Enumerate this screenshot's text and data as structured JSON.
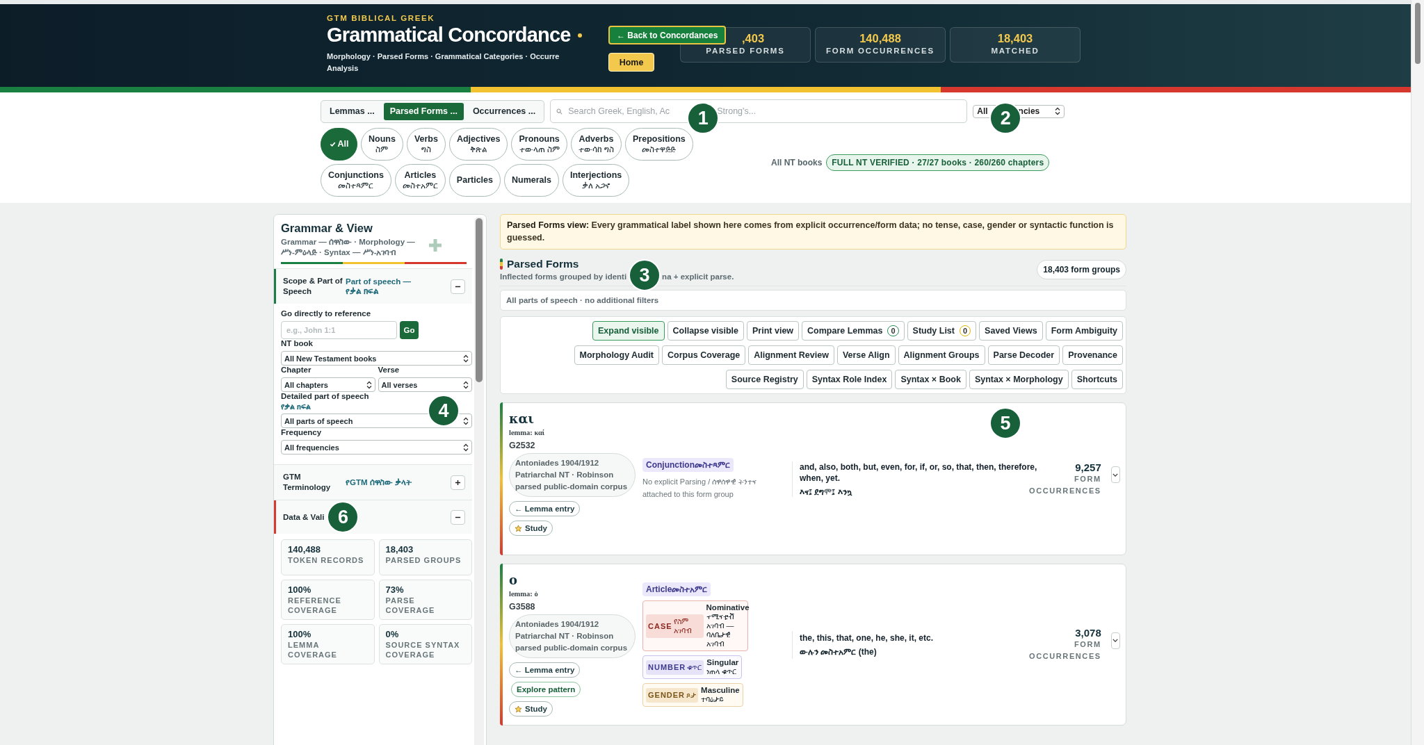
{
  "header": {
    "eyebrow": "GTM BIBLICAL GREEK",
    "title": "Grammatical Concordance",
    "subtitle_lines": [
      "Morphology · Parsed Forms · Grammatical Categories · Occurre",
      "Analysis"
    ],
    "back_button": "← Back to Concordances",
    "home_button": "Home",
    "stats": [
      {
        "value": ",403",
        "label": "PARSED FORMS"
      },
      {
        "value": "140,488",
        "label": "FORM OCCURRENCES"
      },
      {
        "value": "18,403",
        "label": "MATCHED"
      }
    ]
  },
  "view_tabs": [
    {
      "label": "Lemmas ...",
      "selected": false
    },
    {
      "label": "Parsed Forms ...",
      "selected": true
    },
    {
      "label": "Occurrences ...",
      "selected": false
    }
  ],
  "search": {
    "placeholder": "Search Greek, English, Ac",
    "placeholder_tail": "Strong's..."
  },
  "frequency_select": {
    "value": "All",
    "value_tail": "ncies"
  },
  "pos_chips": [
    {
      "label": "All",
      "selected": true
    },
    {
      "label": "Nouns",
      "amharic": "ስም",
      "selected": false
    },
    {
      "label": "Verbs",
      "amharic": "ግስ",
      "selected": false
    },
    {
      "label": "Adjectives",
      "amharic": "ቅጽል",
      "selected": false
    },
    {
      "label": "Pronouns",
      "amharic": "ተውላጠ ስም",
      "selected": false
    },
    {
      "label": "Adverbs",
      "amharic": "ተውሳከ ግስ",
      "selected": false
    },
    {
      "label": "Prepositions",
      "amharic": "መስተዋድድ",
      "selected": false
    },
    {
      "label": "Conjunctions",
      "amharic": "መስተጻምር",
      "selected": false
    },
    {
      "label": "Articles",
      "amharic": "መስተአምር",
      "selected": false
    },
    {
      "label": "Particles",
      "selected": false
    },
    {
      "label": "Numerals",
      "selected": false
    },
    {
      "label": "Interjections",
      "amharic": "ቃለ አጋኖ",
      "selected": false
    }
  ],
  "coverage": {
    "label": "All NT books",
    "badge": "FULL NT VERIFIED · 27/27 books · 260/260 chapters"
  },
  "sidebar": {
    "title": "Grammar & View",
    "subtitle": "Grammar — ሰዋስው · Morphology — ሥነ-ምዕላድ · Syntax — ሥነ-አገባብ",
    "sections": [
      {
        "kind": "filters",
        "title": "Scope & Part of Speech",
        "aside": "Part of speech — የቃል ክፍል",
        "expanded": true,
        "color": "#1e7b45",
        "reference": {
          "label": "Go directly to reference",
          "placeholder": "e.g., John 1:1",
          "button": "Go"
        },
        "field_rows": [
          [
            {
              "label": "NT book",
              "value": "All New Testament books"
            }
          ],
          [
            {
              "label": "Chapter",
              "value": "All chapters"
            },
            {
              "label": "Verse",
              "value": "All verses"
            }
          ],
          [
            {
              "label": "Detailed part of speech",
              "label_am": "የቃል ክፍል",
              "value": "All parts of speech"
            }
          ],
          [
            {
              "label": "Frequency",
              "value": "All frequencies"
            }
          ]
        ]
      },
      {
        "kind": "terms",
        "title": "GTM Terminology",
        "aside": "የGTM ሰዋስው ቃላት",
        "expanded": false
      },
      {
        "kind": "stats",
        "title": "Data & Vali",
        "expanded": true,
        "color": "#d63a2f",
        "tiles": [
          {
            "value": "140,488",
            "label": "TOKEN RECORDS"
          },
          {
            "value": "18,403",
            "label": "PARSED GROUPS"
          },
          {
            "value": "100%",
            "label": "REFERENCE COVERAGE"
          },
          {
            "value": "73%",
            "label": "PARSE COVERAGE"
          },
          {
            "value": "100%",
            "label": "LEMMA COVERAGE"
          },
          {
            "value": "0%",
            "label": "SOURCE SYNTAX COVERAGE"
          }
        ]
      }
    ]
  },
  "notice": "**Parsed Forms view:** Every grammatical label shown here comes from explicit occurrence/form data; no tense, case, gender or syntactic function is guessed.",
  "results": {
    "title": "Parsed Forms",
    "subtitle": "Inflected forms grouped by identi",
    "subtitle_tail": "na + explicit parse.",
    "count": "18,403 form groups"
  },
  "filter_summary": "All parts of speech · no additional filters",
  "tool_rows": [
    [
      {
        "label": "Expand visible",
        "selected": true
      },
      {
        "label": "Collapse visible",
        "selected": false
      },
      {
        "label": "Print view",
        "selected": false
      },
      {
        "label": "Compare Lemmas",
        "count": "0",
        "color": "#2e8b57",
        "selected": false
      },
      {
        "label": "Study List",
        "count": "0",
        "color": "#e0b400",
        "selected": false
      },
      {
        "label": "Saved Views",
        "selected": false
      },
      {
        "label": "Form Ambiguity",
        "selected": false
      }
    ],
    [
      {
        "label": "Morphology Audit",
        "selected": false
      },
      {
        "label": "Corpus Coverage",
        "selected": false
      },
      {
        "label": "Alignment Review",
        "selected": false
      },
      {
        "label": "Verse Align",
        "selected": false
      },
      {
        "label": "Alignment Groups",
        "selected": false
      },
      {
        "label": "Parse Decoder",
        "selected": false
      },
      {
        "label": "Provenance",
        "selected": false
      }
    ],
    [
      {
        "label": "Source Registry",
        "selected": false
      },
      {
        "label": "Syntax Role Index",
        "selected": false
      },
      {
        "label": "Syntax × Book",
        "selected": false
      },
      {
        "label": "Syntax × Morphology",
        "selected": false
      },
      {
        "label": "Shortcuts",
        "selected": false
      }
    ]
  ],
  "cards": [
    {
      "form": "και",
      "lemma": "lemma: καί",
      "strongs": "G2532",
      "source": "Antoniades 1904/1912 Patriarchal NT · Robinson parsed public-domain corpus",
      "actions": [
        {
          "kind": "lemma",
          "label": "← Lemma entry"
        },
        {
          "kind": "study",
          "label": "Study"
        }
      ],
      "pos": "Conjunction",
      "pos_am": "መስተጻምር",
      "note": "No explicit Parsing / ሰዋሰዋዊ ትንተና attached to this form group",
      "gloss": "and, also, both, but, even, for, if, or, so, that, then, therefore, when, yet.",
      "gloss_am": "እና፤ ደግሞ፤ እንኳ",
      "count": "9,257",
      "count_label": "FORM OCCURRENCES"
    },
    {
      "form": "ο",
      "lemma": "lemma: ὁ",
      "strongs": "G3588",
      "source": "Antoniades 1904/1912 Patriarchal NT · Robinson parsed public-domain corpus",
      "actions": [
        {
          "kind": "lemma",
          "label": "← Lemma entry"
        },
        {
          "kind": "explore",
          "label": "Explore pattern"
        },
        {
          "kind": "study",
          "label": "Study"
        }
      ],
      "pos": "Article",
      "pos_am": "መስተአምር",
      "features": [
        {
          "kind": "case",
          "label": "CASE",
          "label_am": "የስም አገባብ",
          "value": "Nominative",
          "value_am": "ኖሚናቲቭ አገባብ — ባለቤታዊ አገባብ"
        },
        {
          "kind": "number",
          "label": "NUMBER",
          "label_am": "ቁጥር",
          "value": "Singular",
          "value_am": "ነጠላ ቁጥር"
        },
        {
          "kind": "gender",
          "label": "GENDER",
          "label_am": "ጾታ",
          "value": "Masculine",
          "value_am": "ተባዕታይ"
        }
      ],
      "gloss": "the, this, that, one, he, she, it, etc.",
      "gloss_am": "ውሉን መስተአምር (the)",
      "count": "3,078",
      "count_label": "FORM OCCURRENCES"
    }
  ],
  "markers": [
    "1",
    "2",
    "3",
    "4",
    "5",
    "6"
  ]
}
